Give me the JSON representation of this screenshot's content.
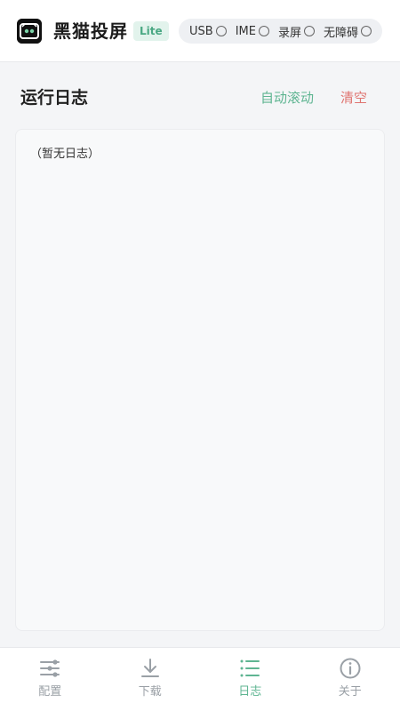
{
  "header": {
    "app_name": "黑猫投屏",
    "badge": "Lite",
    "status": [
      {
        "label": "USB",
        "active": false
      },
      {
        "label": "IME",
        "active": false
      },
      {
        "label": "录屏",
        "active": false
      },
      {
        "label": "无障碍",
        "active": false
      }
    ]
  },
  "log": {
    "title": "运行日志",
    "auto_scroll_label": "自动滚动",
    "clear_label": "清空",
    "empty_text": "（暂无日志）"
  },
  "nav": {
    "active_index": 2,
    "items": [
      {
        "label": "配置",
        "icon": "sliders-icon"
      },
      {
        "label": "下载",
        "icon": "download-icon"
      },
      {
        "label": "日志",
        "icon": "list-icon"
      },
      {
        "label": "关于",
        "icon": "info-icon"
      }
    ]
  },
  "colors": {
    "accent": "#5fb592",
    "danger": "#df7470",
    "inactive": "#9aa0a6"
  }
}
